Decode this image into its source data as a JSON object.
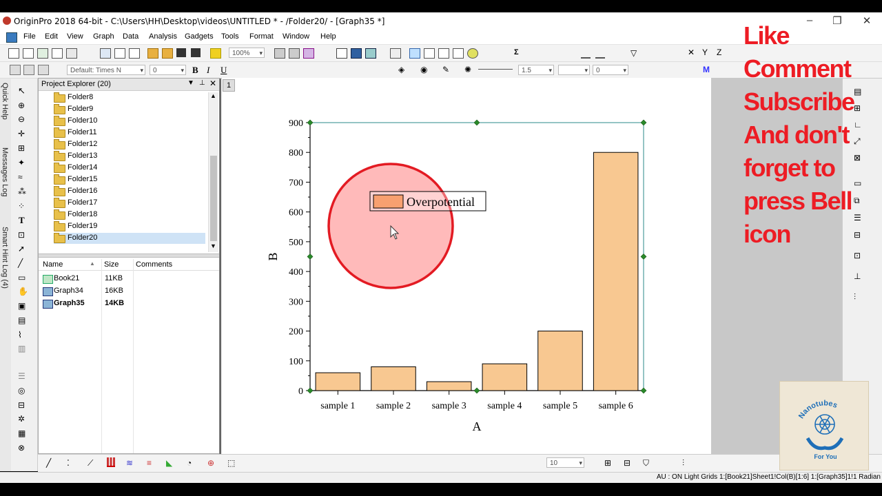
{
  "window": {
    "title": "OriginPro 2018 64-bit - C:\\Users\\HH\\Desktop\\videos\\UNTITLED * - /Folder20/ - [Graph35 *]"
  },
  "menu": [
    "File",
    "Edit",
    "View",
    "Graph",
    "Data",
    "Analysis",
    "Gadgets",
    "Tools",
    "Format",
    "Window",
    "Help"
  ],
  "toolbar": {
    "zoom": "100%",
    "font": "Default: Times N",
    "font_size": "0",
    "line_width": "1.5",
    "field_3": "0",
    "bottom_value": "10",
    "bold": "B",
    "italic": "I",
    "underline": "U"
  },
  "side_tabs": [
    "Quick Help",
    "Messages Log",
    "Smart Hint Log (4)"
  ],
  "project_explorer": {
    "title": "Project Explorer (20)",
    "folders": [
      "Folder8",
      "Folder9",
      "Folder10",
      "Folder11",
      "Folder12",
      "Folder13",
      "Folder14",
      "Folder15",
      "Folder16",
      "Folder17",
      "Folder18",
      "Folder19",
      "Folder20"
    ],
    "selected_folder": "Folder20",
    "columns": [
      "Name",
      "Size",
      "Comments"
    ],
    "files": [
      {
        "name": "Book21",
        "size": "11KB",
        "type": "workbook"
      },
      {
        "name": "Graph34",
        "size": "16KB",
        "type": "graph"
      },
      {
        "name": "Graph35",
        "size": "14KB",
        "type": "graph"
      }
    ]
  },
  "page_number": "1",
  "chart_data": {
    "type": "bar",
    "categories": [
      "sample 1",
      "sample 2",
      "sample 3",
      "sample 4",
      "sample 5",
      "sample 6"
    ],
    "series": [
      {
        "name": "Overpotential",
        "values": [
          60,
          80,
          30,
          90,
          200,
          800
        ]
      }
    ],
    "xlabel": "A",
    "ylabel": "B",
    "ylim": [
      0,
      900
    ],
    "yticks": [
      0,
      100,
      200,
      300,
      400,
      500,
      600,
      700,
      800,
      900
    ],
    "bar_color": "#f8c891",
    "legend_swatch": "#f8a070",
    "grid": false,
    "legend_position": "top-left"
  },
  "status": "AU : ON  Light Grids  1:[Book21]Sheet1!Col(B)[1:6]  1:[Graph35]1!1  Radian",
  "overlay": [
    "Like",
    "Comment",
    "Subscribe",
    "And don't",
    "forget to",
    "press Bell",
    "icon"
  ],
  "logo_text": {
    "top": "Nanotubes",
    "bottom": "For You"
  },
  "colors": {
    "overlay": "#ed1c24",
    "highlight_circle": "#e31b23"
  }
}
